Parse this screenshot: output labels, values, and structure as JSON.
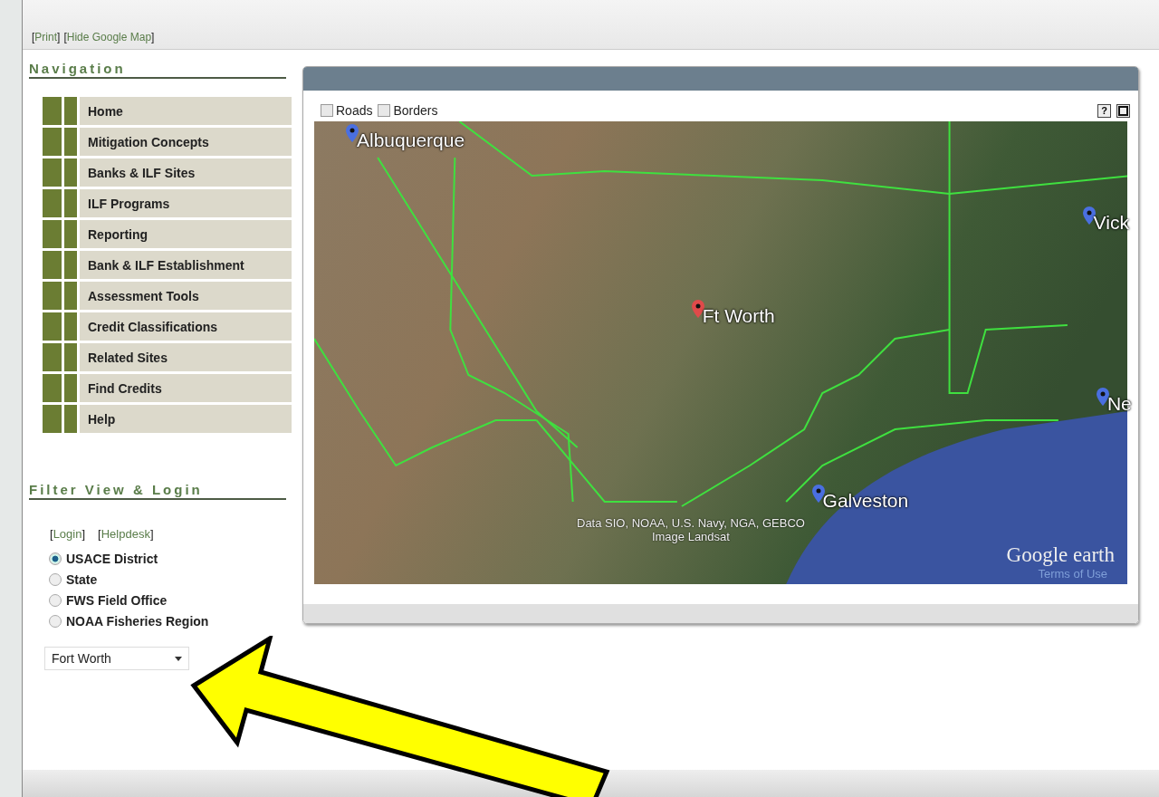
{
  "top_links": [
    {
      "open": "[",
      "label": "Print",
      "close": "]"
    },
    {
      "open": "[",
      "label": "Hide Google Map",
      "close": "]"
    }
  ],
  "navigation": {
    "title": "Navigation",
    "items": [
      "Home",
      "Mitigation Concepts",
      "Banks & ILF Sites",
      "ILF Programs",
      "Reporting",
      "Bank & ILF Establishment",
      "Assessment Tools",
      "Credit Classifications",
      "Related Sites",
      "Find Credits",
      "Help"
    ]
  },
  "filter": {
    "title": "Filter View & Login",
    "links": [
      {
        "open": "[",
        "label": "Login",
        "close": "]"
      },
      {
        "open": "[",
        "label": "Helpdesk",
        "close": "]"
      }
    ],
    "options": [
      {
        "label": "USACE District",
        "selected": true
      },
      {
        "label": "State",
        "selected": false
      },
      {
        "label": "FWS Field Office",
        "selected": false
      },
      {
        "label": "NOAA Fisheries Region",
        "selected": false
      }
    ],
    "dropdown": {
      "value": "Fort Worth"
    }
  },
  "map": {
    "layers": [
      {
        "label": "Roads",
        "checked": false
      },
      {
        "label": "Borders",
        "checked": false
      }
    ],
    "help_button": "?",
    "markers": [
      {
        "label": "Albuquerque",
        "color": "#4a6fe0"
      },
      {
        "label": "Vick",
        "color": "#4a6fe0"
      },
      {
        "label": "Ft Worth",
        "color": "#e04a4a"
      },
      {
        "label": "Ne",
        "color": "#4a6fe0"
      },
      {
        "label": "Galveston",
        "color": "#4a6fe0"
      }
    ],
    "attribution": [
      "Data SIO, NOAA, U.S. Navy, NGA, GEBCO",
      "Image Landsat"
    ],
    "logo": "Google earth",
    "terms": "Terms of Use"
  }
}
